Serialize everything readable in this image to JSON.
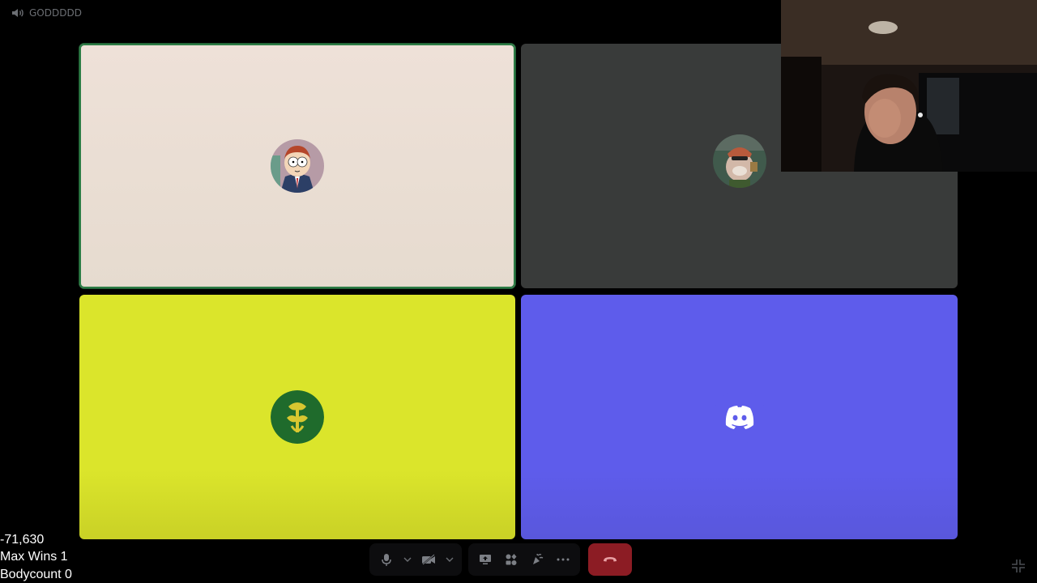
{
  "channel": {
    "name": "GODDDDD",
    "icon": "speaker-icon"
  },
  "tiles": [
    {
      "name": "participant-tile-1",
      "avatar": "morty-avatar",
      "speaking": true,
      "bg": "#eee1d8"
    },
    {
      "name": "participant-tile-2",
      "avatar": "cartoon-character-avatar",
      "speaking": false,
      "bg": "#393b3a"
    },
    {
      "name": "participant-tile-3",
      "avatar": "green-emblem-avatar",
      "speaking": false,
      "bg": "#dbe52b"
    },
    {
      "name": "participant-tile-4",
      "avatar": "discord-logo-avatar",
      "speaking": false,
      "bg": "#5e5ceb"
    }
  ],
  "overlay": {
    "score": "-71,630",
    "max_wins": "Max Wins 1",
    "bodycount": "Bodycount 0"
  },
  "controls": {
    "mic": "microphone-icon",
    "camera": "camera-off-icon",
    "screen_share": "screen-share-icon",
    "activities": "activities-icon",
    "soundboard": "soundboard-icon",
    "more": "more-icon",
    "disconnect": "hang-up-icon"
  },
  "colors": {
    "disconnect": "#8c1c24",
    "speaking_ring": "#2d7d46",
    "discord_blurple": "#5e5ceb"
  }
}
